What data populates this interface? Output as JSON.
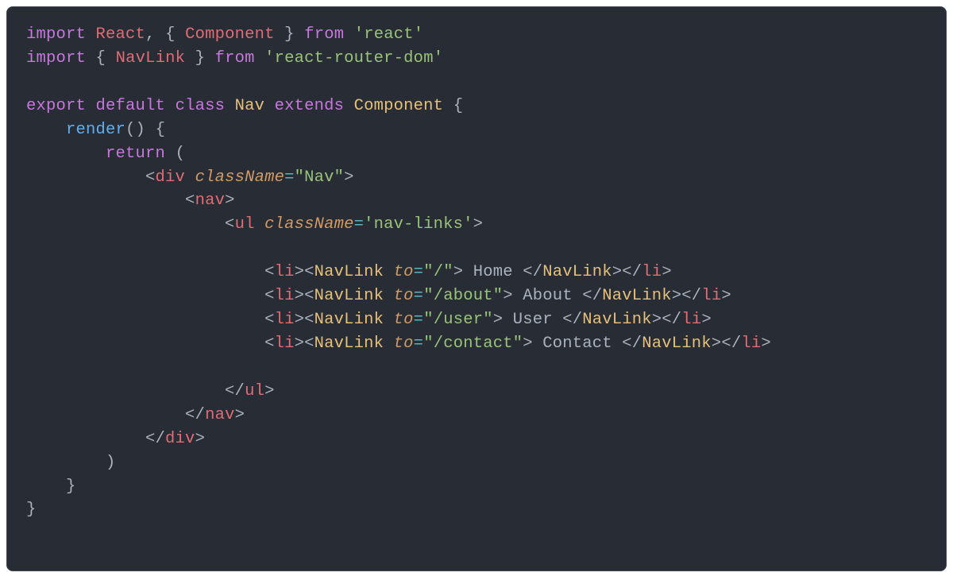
{
  "imports": {
    "kw_import_1": "import",
    "react_ident": "React",
    "comma1": ",",
    "lbrace1": "{",
    "component_ident": "Component",
    "rbrace1": "}",
    "kw_from_1": "from",
    "react_pkg": "'react'",
    "kw_import_2": "import",
    "lbrace2": "{",
    "navlink_ident": "NavLink",
    "rbrace2": "}",
    "kw_from_2": "from",
    "router_pkg": "'react-router-dom'"
  },
  "decl": {
    "kw_export": "export",
    "kw_default": "default",
    "kw_class": "class",
    "class_name": "Nav",
    "kw_extends": "extends",
    "base_class": "Component",
    "lbrace": "{",
    "render_name": "render",
    "render_parens": "()",
    "render_lbrace": "{",
    "kw_return": "return",
    "return_lparen": "(",
    "return_rparen": ")",
    "render_rbrace": "}",
    "rbrace": "}"
  },
  "jsx": {
    "div_open_lt": "<",
    "div_tag": "div",
    "attr_className": "className",
    "eq": "=",
    "className_val": "\"Nav\"",
    "gt": ">",
    "nav_tag": "nav",
    "ul_tag": "ul",
    "ul_className_val": "'nav-links'",
    "li_tag": "li",
    "navlink_tag": "NavLink",
    "attr_to": "to",
    "items": [
      {
        "to_val": "\"/\"",
        "text": " Home "
      },
      {
        "to_val": "\"/about\"",
        "text": " About "
      },
      {
        "to_val": "\"/user\"",
        "text": " User "
      },
      {
        "to_val": "\"/contact\"",
        "text": " Contact "
      }
    ],
    "slash": "/",
    "lt": "<",
    "close_ul": "</",
    "close_nav": "</",
    "close_div": "</"
  }
}
